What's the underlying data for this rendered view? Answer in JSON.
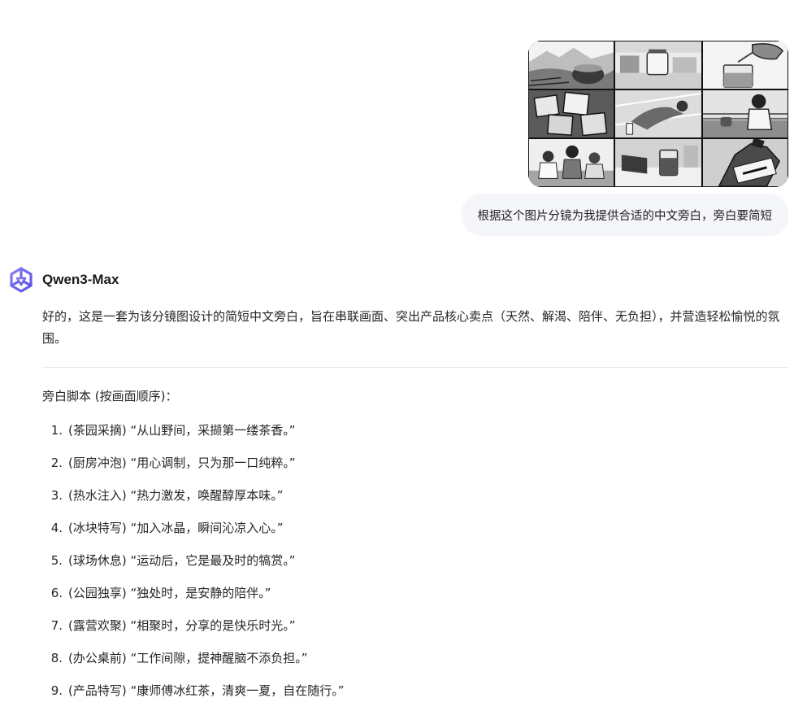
{
  "user": {
    "message": "根据这个图片分镜为我提供合适的中文旁白，旁白要简短"
  },
  "assistant": {
    "model_name": "Qwen3-Max",
    "intro": "好的，这是一套为该分镜图设计的简短中文旁白，旨在串联画面、突出产品核心卖点（天然、解渴、陪伴、无负担），并营造轻松愉悦的氛围。",
    "script_heading": "旁白脚本 (按画面顺序)：",
    "script_items": [
      {
        "number": "1.",
        "text": "(茶园采摘) “从山野间，采撷第一缕茶香。”"
      },
      {
        "number": "2.",
        "text": "(厨房冲泡) “用心调制，只为那一口纯粹。”"
      },
      {
        "number": "3.",
        "text": "(热水注入) “热力激发，唤醒醇厚本味。”"
      },
      {
        "number": "4.",
        "text": "(冰块特写) “加入冰晶，瞬间沁凉入心。”"
      },
      {
        "number": "5.",
        "text": "(球场休息) “运动后，它是最及时的犒赏。”"
      },
      {
        "number": "6.",
        "text": "(公园独享) “独处时，是安静的陪伴。”"
      },
      {
        "number": "7.",
        "text": "(露营欢聚) “相聚时，分享的是快乐时光。”"
      },
      {
        "number": "8.",
        "text": "(办公桌前) “工作间隙，提神醒脑不添负担。”"
      },
      {
        "number": "9.",
        "text": "(产品特写) “康师傅冰红茶，清爽一夏，自在随行。”"
      }
    ]
  },
  "icons": {
    "logo": "qwen-logo-icon"
  },
  "colors": {
    "user_bubble_bg": "#f5f6fa",
    "logo_primary": "#615ced",
    "logo_secondary": "#8a7df0",
    "divider": "#e6e6e6"
  }
}
